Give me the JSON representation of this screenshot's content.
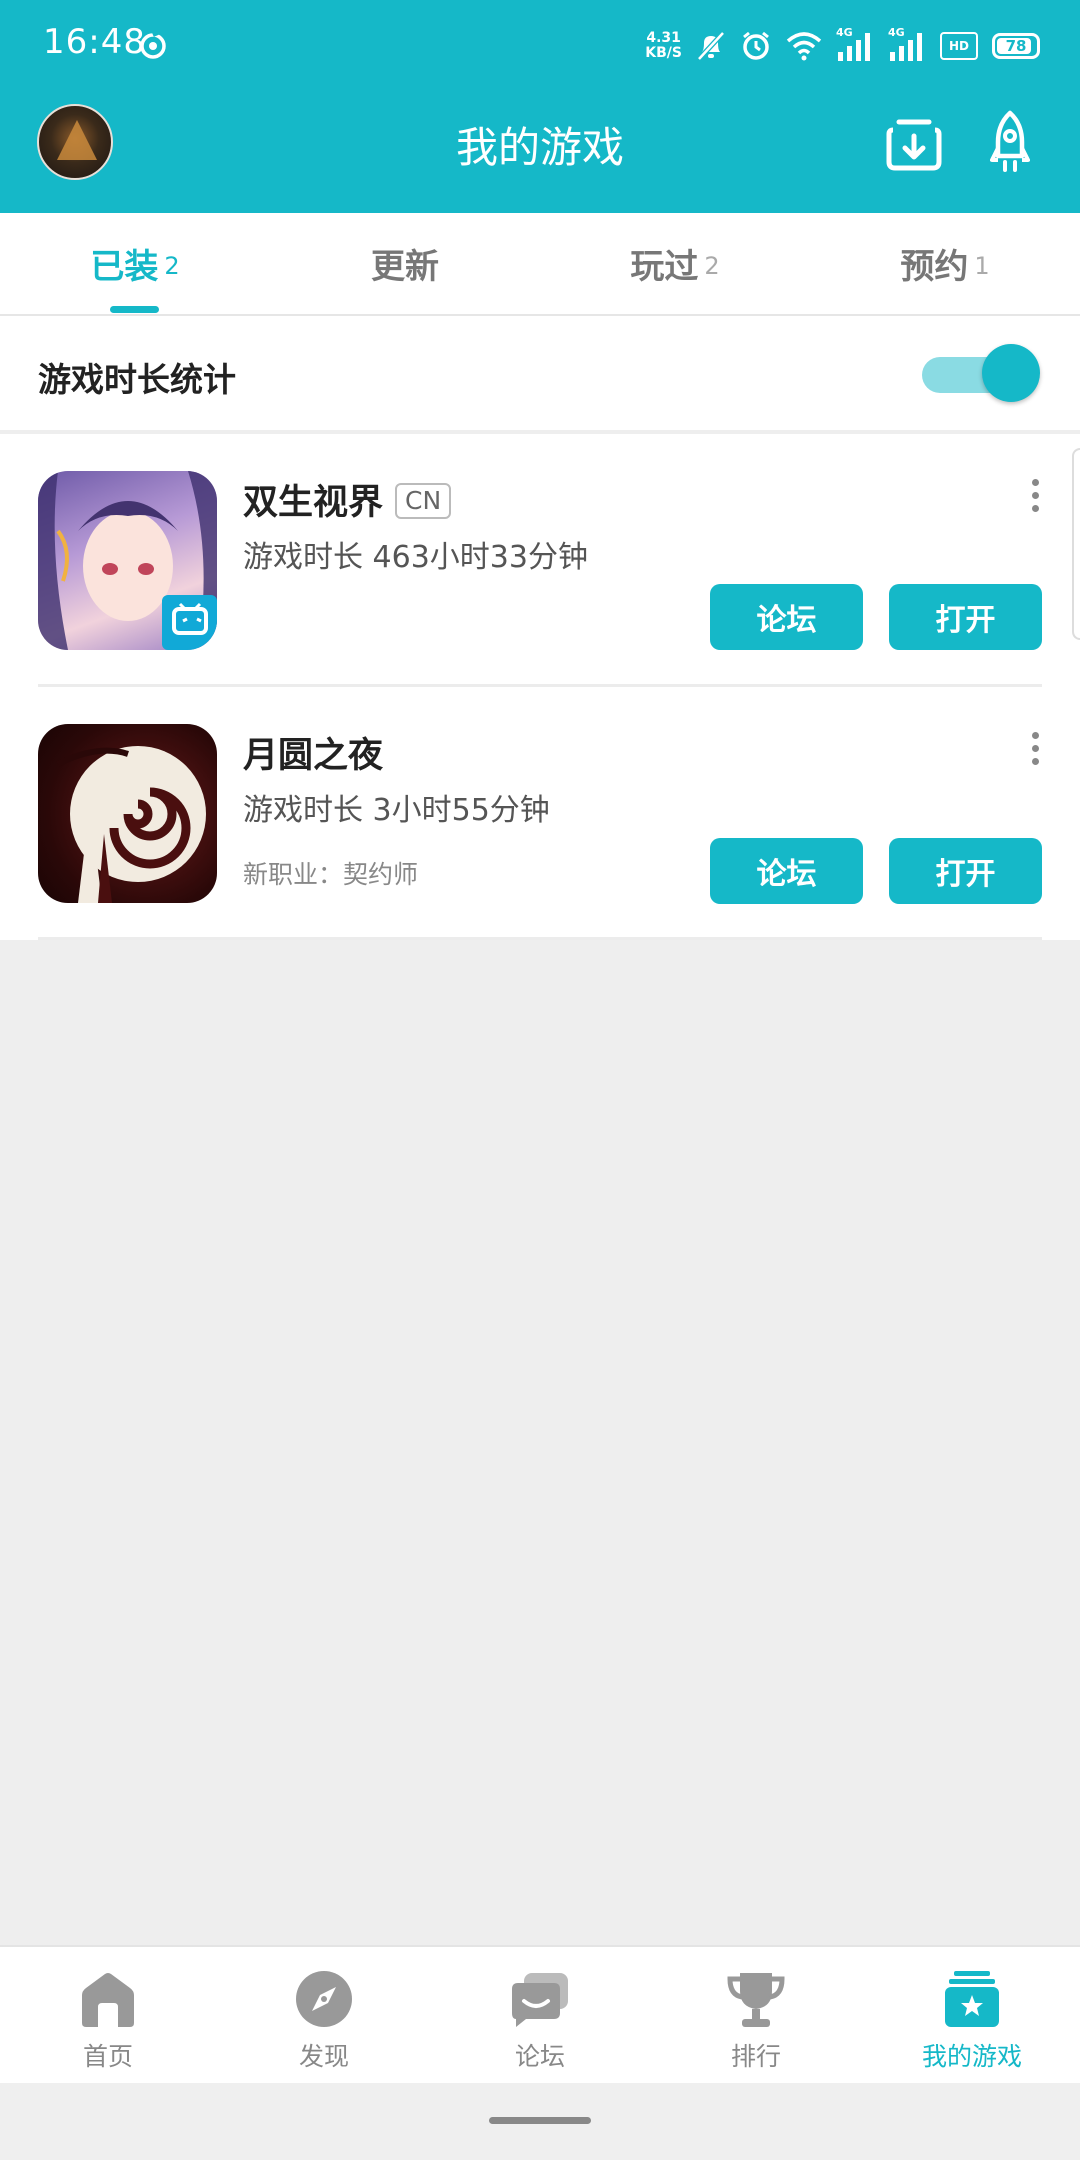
{
  "status_bar": {
    "time": "16:48",
    "net_speed_value": "4.31",
    "net_speed_unit": "KB/S",
    "battery": "78",
    "signal_label_1": "4G",
    "signal_label_2": "4G",
    "hd_label": "HD"
  },
  "header": {
    "title": "我的游戏"
  },
  "tabs": [
    {
      "label": "已装",
      "count": "2",
      "active": true
    },
    {
      "label": "更新",
      "count": ""
    },
    {
      "label": "玩过",
      "count": "2"
    },
    {
      "label": "预约",
      "count": "1"
    }
  ],
  "stats": {
    "label": "游戏时长统计",
    "enabled": true
  },
  "games": [
    {
      "name": "双生视界",
      "tag": "CN",
      "playtime": "游戏时长 463小时33分钟",
      "note": "",
      "forum_label": "论坛",
      "open_label": "打开"
    },
    {
      "name": "月圆之夜",
      "tag": "",
      "playtime": "游戏时长 3小时55分钟",
      "note": "新职业：契约师",
      "forum_label": "论坛",
      "open_label": "打开"
    }
  ],
  "bottom_nav": [
    {
      "label": "首页",
      "icon": "home-icon"
    },
    {
      "label": "发现",
      "icon": "compass-icon"
    },
    {
      "label": "论坛",
      "icon": "forum-icon"
    },
    {
      "label": "排行",
      "icon": "trophy-icon"
    },
    {
      "label": "我的游戏",
      "icon": "my-games-icon",
      "active": true
    }
  ],
  "colors": {
    "accent": "#15b8c8",
    "inactive": "#888888",
    "background": "#eeeeee"
  }
}
